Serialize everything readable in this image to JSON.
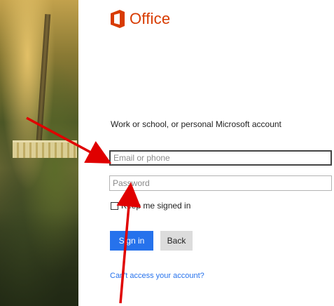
{
  "logo": {
    "text": "Office",
    "brand_color": "#d83b01"
  },
  "login": {
    "heading": "Work or school, or personal Microsoft account",
    "email_placeholder": "Email or phone",
    "password_placeholder": "Password",
    "keep_signed_in_label": "Keep me signed in",
    "sign_in_label": "Sign in",
    "back_label": "Back",
    "cant_access_label": "Can't access your account?"
  },
  "colors": {
    "accent": "#2672ec",
    "annotation": "#e00000"
  },
  "icons": [
    "office-logo-icon",
    "checkbox-icon",
    "annotation-arrow"
  ]
}
